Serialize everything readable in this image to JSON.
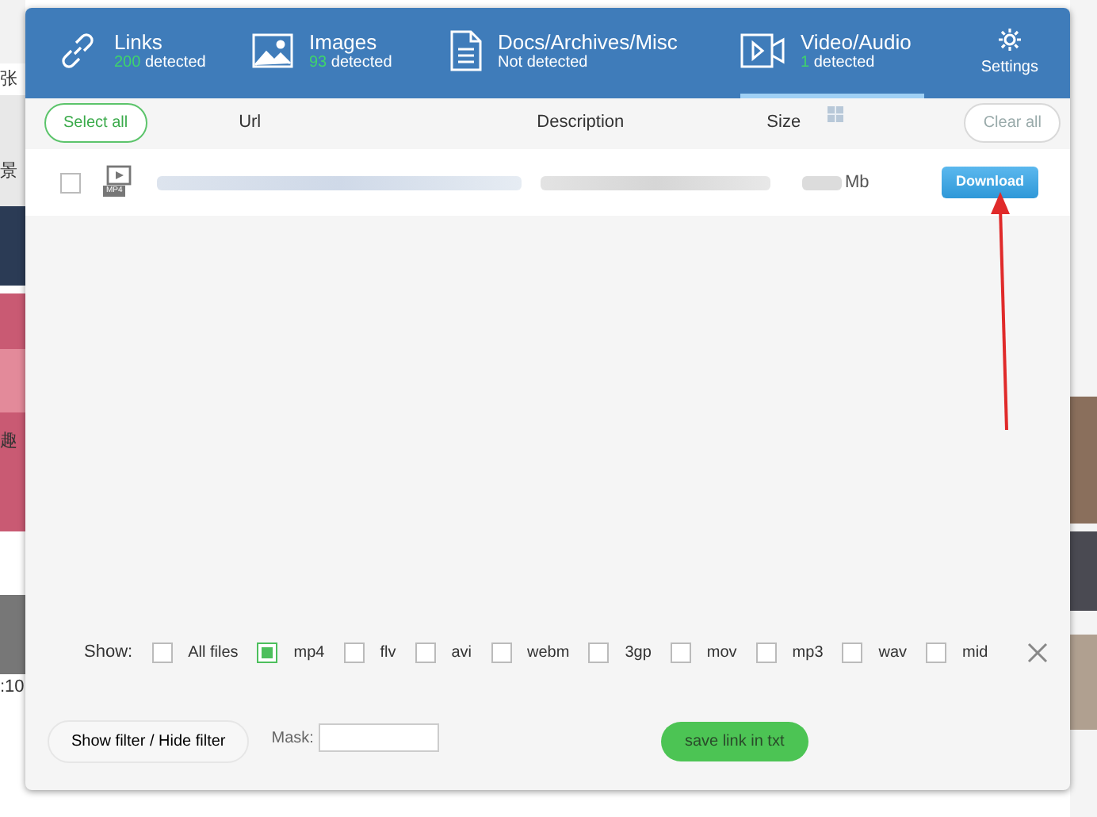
{
  "background_page": {
    "texts": [
      "张",
      "景",
      "趣",
      ":10"
    ]
  },
  "tabs": [
    {
      "label": "Links",
      "count": "200",
      "status": "detected",
      "selected": false
    },
    {
      "label": "Images",
      "count": "93",
      "status": "detected",
      "selected": false
    },
    {
      "label": "Docs/Archives/Misc",
      "status": "Not detected",
      "selected": false
    },
    {
      "label": "Video/Audio",
      "count": "1",
      "status": "detected",
      "selected": true
    }
  ],
  "settings": {
    "label": "Settings"
  },
  "columns": {
    "select_all": "Select all",
    "url": "Url",
    "description": "Description",
    "size": "Size",
    "clear_all": "Clear all"
  },
  "rows": [
    {
      "checked": false,
      "type_badge": "MP4",
      "size_unit": "Mb",
      "action": "Download"
    }
  ],
  "filter": {
    "label": "Show:",
    "options": [
      {
        "label": "All files",
        "checked": false
      },
      {
        "label": "mp4",
        "checked": true
      },
      {
        "label": "flv",
        "checked": false
      },
      {
        "label": "avi",
        "checked": false
      },
      {
        "label": "webm",
        "checked": false
      },
      {
        "label": "3gp",
        "checked": false
      },
      {
        "label": "mov",
        "checked": false
      },
      {
        "label": "mp3",
        "checked": false
      },
      {
        "label": "wav",
        "checked": false
      },
      {
        "label": "mid",
        "checked": false
      }
    ]
  },
  "footer": {
    "toggle_filter": "Show filter / Hide filter",
    "mask_label": "Mask:",
    "save": "save link in txt"
  }
}
